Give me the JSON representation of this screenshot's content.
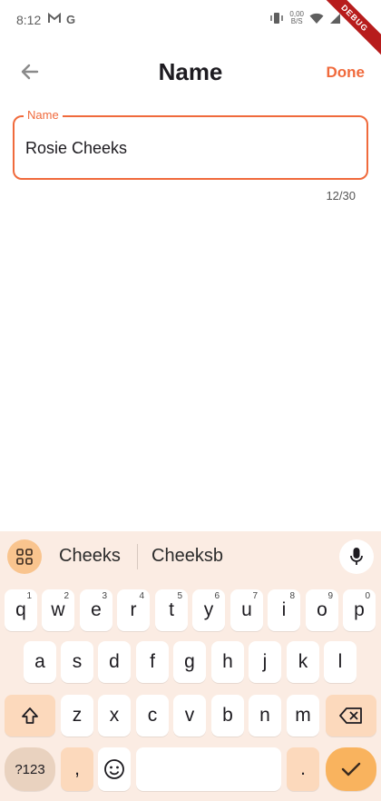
{
  "status": {
    "time": "8:12",
    "left_icons": [
      "gmail-icon",
      "google-icon"
    ],
    "net_speed_value": "0,00",
    "net_speed_unit": "B/S",
    "debug_banner": "DEBUG"
  },
  "app_bar": {
    "title": "Name",
    "done_label": "Done",
    "accent_color": "#f06a3c"
  },
  "field": {
    "label": "Name",
    "value": "Rosie Cheeks",
    "counter": "12/30"
  },
  "keyboard": {
    "suggestions": [
      "Cheeks",
      "Cheeksb"
    ],
    "row1": [
      {
        "key": "q",
        "hint": "1"
      },
      {
        "key": "w",
        "hint": "2"
      },
      {
        "key": "e",
        "hint": "3"
      },
      {
        "key": "r",
        "hint": "4"
      },
      {
        "key": "t",
        "hint": "5"
      },
      {
        "key": "y",
        "hint": "6"
      },
      {
        "key": "u",
        "hint": "7"
      },
      {
        "key": "i",
        "hint": "8"
      },
      {
        "key": "o",
        "hint": "9"
      },
      {
        "key": "p",
        "hint": "0"
      }
    ],
    "row2": [
      "a",
      "s",
      "d",
      "f",
      "g",
      "h",
      "j",
      "k",
      "l"
    ],
    "row3": [
      "z",
      "x",
      "c",
      "v",
      "b",
      "n",
      "m"
    ],
    "symbols_label": "?123",
    "comma_label": ",",
    "period_label": "."
  }
}
